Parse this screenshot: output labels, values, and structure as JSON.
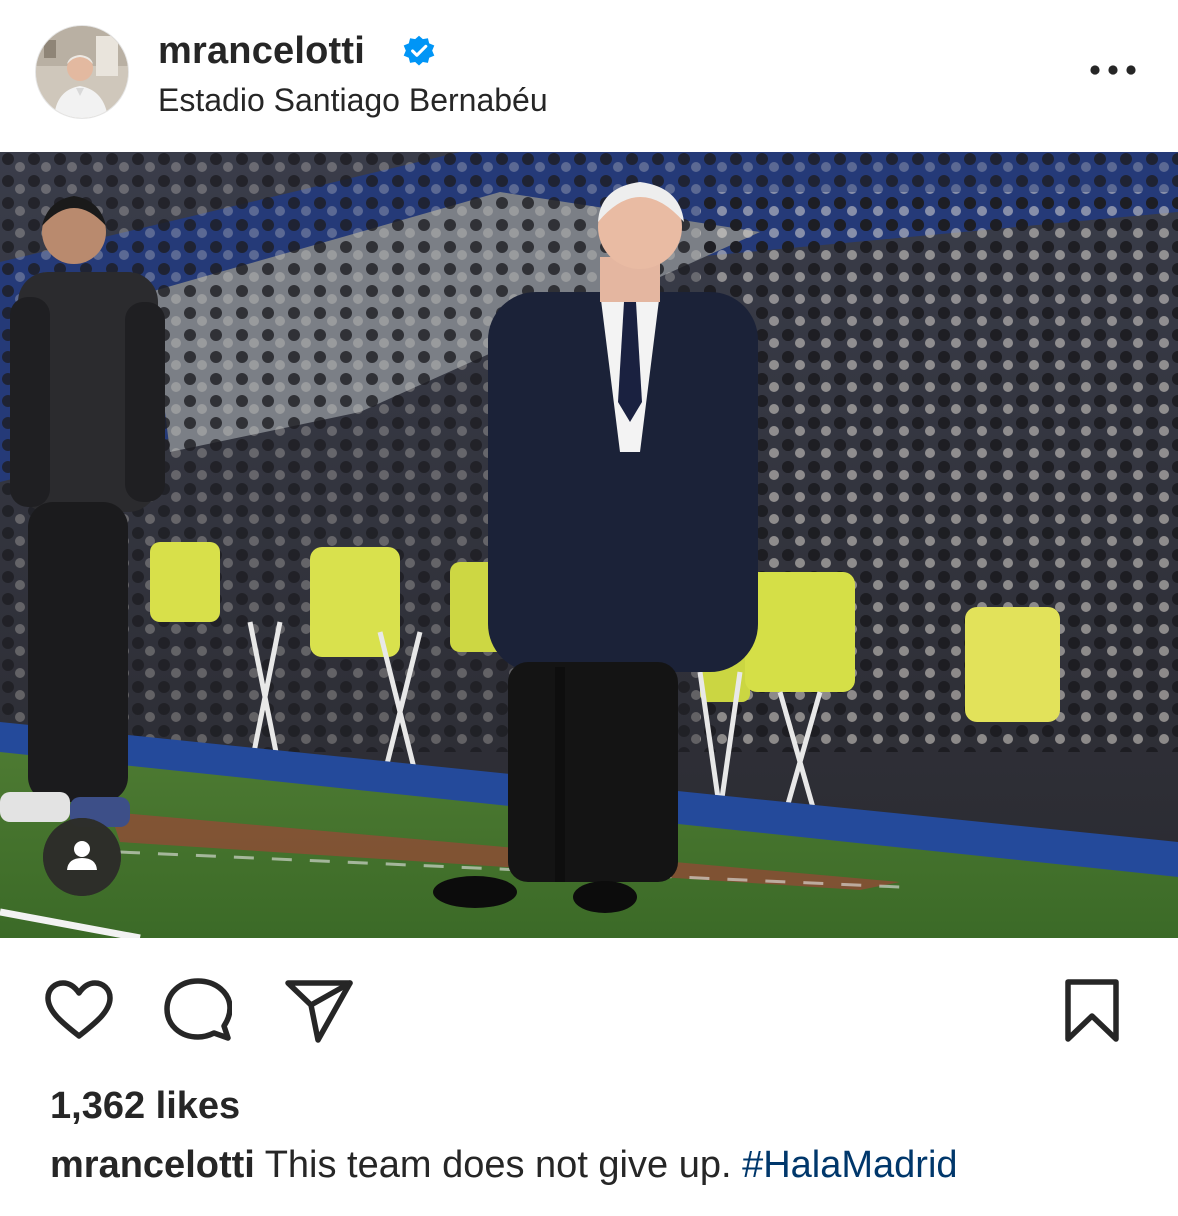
{
  "post": {
    "username": "mrancelotti",
    "verified": true,
    "location": "Estadio Santiago Bernabéu",
    "likes": "1,362 likes",
    "caption": {
      "username": "mrancelotti",
      "text": "This team does not give up.",
      "hashtag": "#HalaMadrid"
    }
  },
  "icons": {
    "more": "more-horizontal-icon",
    "like": "heart-icon",
    "comment": "comment-icon",
    "share": "paper-plane-icon",
    "save": "bookmark-icon",
    "tag": "person-tag-icon",
    "verified": "verified-badge-icon"
  },
  "colors": {
    "text": "#262626",
    "verified": "#0095f6",
    "hashtag": "#00376b"
  }
}
